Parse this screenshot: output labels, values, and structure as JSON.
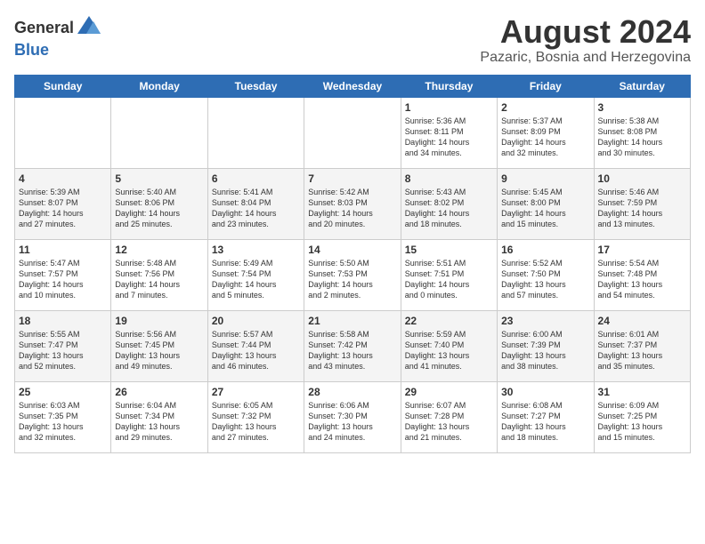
{
  "header": {
    "logo_general": "General",
    "logo_blue": "Blue",
    "month": "August 2024",
    "location": "Pazaric, Bosnia and Herzegovina"
  },
  "days_of_week": [
    "Sunday",
    "Monday",
    "Tuesday",
    "Wednesday",
    "Thursday",
    "Friday",
    "Saturday"
  ],
  "weeks": [
    [
      {
        "day": "",
        "info": ""
      },
      {
        "day": "",
        "info": ""
      },
      {
        "day": "",
        "info": ""
      },
      {
        "day": "",
        "info": ""
      },
      {
        "day": "1",
        "info": "Sunrise: 5:36 AM\nSunset: 8:11 PM\nDaylight: 14 hours\nand 34 minutes."
      },
      {
        "day": "2",
        "info": "Sunrise: 5:37 AM\nSunset: 8:09 PM\nDaylight: 14 hours\nand 32 minutes."
      },
      {
        "day": "3",
        "info": "Sunrise: 5:38 AM\nSunset: 8:08 PM\nDaylight: 14 hours\nand 30 minutes."
      }
    ],
    [
      {
        "day": "4",
        "info": "Sunrise: 5:39 AM\nSunset: 8:07 PM\nDaylight: 14 hours\nand 27 minutes."
      },
      {
        "day": "5",
        "info": "Sunrise: 5:40 AM\nSunset: 8:06 PM\nDaylight: 14 hours\nand 25 minutes."
      },
      {
        "day": "6",
        "info": "Sunrise: 5:41 AM\nSunset: 8:04 PM\nDaylight: 14 hours\nand 23 minutes."
      },
      {
        "day": "7",
        "info": "Sunrise: 5:42 AM\nSunset: 8:03 PM\nDaylight: 14 hours\nand 20 minutes."
      },
      {
        "day": "8",
        "info": "Sunrise: 5:43 AM\nSunset: 8:02 PM\nDaylight: 14 hours\nand 18 minutes."
      },
      {
        "day": "9",
        "info": "Sunrise: 5:45 AM\nSunset: 8:00 PM\nDaylight: 14 hours\nand 15 minutes."
      },
      {
        "day": "10",
        "info": "Sunrise: 5:46 AM\nSunset: 7:59 PM\nDaylight: 14 hours\nand 13 minutes."
      }
    ],
    [
      {
        "day": "11",
        "info": "Sunrise: 5:47 AM\nSunset: 7:57 PM\nDaylight: 14 hours\nand 10 minutes."
      },
      {
        "day": "12",
        "info": "Sunrise: 5:48 AM\nSunset: 7:56 PM\nDaylight: 14 hours\nand 7 minutes."
      },
      {
        "day": "13",
        "info": "Sunrise: 5:49 AM\nSunset: 7:54 PM\nDaylight: 14 hours\nand 5 minutes."
      },
      {
        "day": "14",
        "info": "Sunrise: 5:50 AM\nSunset: 7:53 PM\nDaylight: 14 hours\nand 2 minutes."
      },
      {
        "day": "15",
        "info": "Sunrise: 5:51 AM\nSunset: 7:51 PM\nDaylight: 14 hours\nand 0 minutes."
      },
      {
        "day": "16",
        "info": "Sunrise: 5:52 AM\nSunset: 7:50 PM\nDaylight: 13 hours\nand 57 minutes."
      },
      {
        "day": "17",
        "info": "Sunrise: 5:54 AM\nSunset: 7:48 PM\nDaylight: 13 hours\nand 54 minutes."
      }
    ],
    [
      {
        "day": "18",
        "info": "Sunrise: 5:55 AM\nSunset: 7:47 PM\nDaylight: 13 hours\nand 52 minutes."
      },
      {
        "day": "19",
        "info": "Sunrise: 5:56 AM\nSunset: 7:45 PM\nDaylight: 13 hours\nand 49 minutes."
      },
      {
        "day": "20",
        "info": "Sunrise: 5:57 AM\nSunset: 7:44 PM\nDaylight: 13 hours\nand 46 minutes."
      },
      {
        "day": "21",
        "info": "Sunrise: 5:58 AM\nSunset: 7:42 PM\nDaylight: 13 hours\nand 43 minutes."
      },
      {
        "day": "22",
        "info": "Sunrise: 5:59 AM\nSunset: 7:40 PM\nDaylight: 13 hours\nand 41 minutes."
      },
      {
        "day": "23",
        "info": "Sunrise: 6:00 AM\nSunset: 7:39 PM\nDaylight: 13 hours\nand 38 minutes."
      },
      {
        "day": "24",
        "info": "Sunrise: 6:01 AM\nSunset: 7:37 PM\nDaylight: 13 hours\nand 35 minutes."
      }
    ],
    [
      {
        "day": "25",
        "info": "Sunrise: 6:03 AM\nSunset: 7:35 PM\nDaylight: 13 hours\nand 32 minutes."
      },
      {
        "day": "26",
        "info": "Sunrise: 6:04 AM\nSunset: 7:34 PM\nDaylight: 13 hours\nand 29 minutes."
      },
      {
        "day": "27",
        "info": "Sunrise: 6:05 AM\nSunset: 7:32 PM\nDaylight: 13 hours\nand 27 minutes."
      },
      {
        "day": "28",
        "info": "Sunrise: 6:06 AM\nSunset: 7:30 PM\nDaylight: 13 hours\nand 24 minutes."
      },
      {
        "day": "29",
        "info": "Sunrise: 6:07 AM\nSunset: 7:28 PM\nDaylight: 13 hours\nand 21 minutes."
      },
      {
        "day": "30",
        "info": "Sunrise: 6:08 AM\nSunset: 7:27 PM\nDaylight: 13 hours\nand 18 minutes."
      },
      {
        "day": "31",
        "info": "Sunrise: 6:09 AM\nSunset: 7:25 PM\nDaylight: 13 hours\nand 15 minutes."
      }
    ]
  ]
}
